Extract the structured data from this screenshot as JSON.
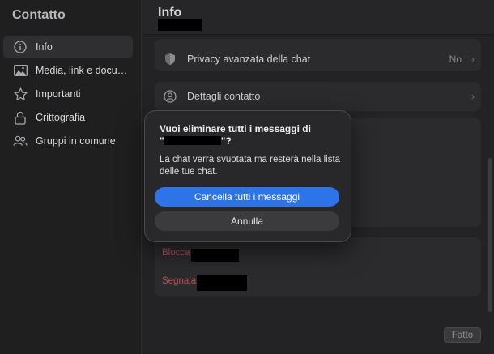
{
  "sidebar": {
    "title": "Contatto",
    "items": [
      {
        "label": "Info",
        "icon": "info-icon"
      },
      {
        "label": "Media, link e documenti",
        "icon": "image-icon"
      },
      {
        "label": "Importanti",
        "icon": "star-icon"
      },
      {
        "label": "Crittografia",
        "icon": "lock-icon"
      },
      {
        "label": "Gruppi in comune",
        "icon": "people-icon"
      }
    ]
  },
  "header": {
    "title": "Info"
  },
  "main": {
    "privacy": {
      "label": "Privacy avanzata della chat",
      "value": "No"
    },
    "contact_details": {
      "label": "Dettagli contatto"
    },
    "block": {
      "label": "Blocca"
    },
    "report": {
      "label": "Segnala"
    },
    "done_label": "Fatto"
  },
  "dialog": {
    "title_prefix": "Vuoi eliminare tutti i messaggi di",
    "title_quote_open": "\"",
    "title_quote_close": "\"?",
    "message": "La chat verrà svuotata ma resterà nella lista delle tue chat.",
    "primary_label": "Cancella tutti i messaggi",
    "secondary_label": "Annulla"
  },
  "colors": {
    "accent": "#2d74e8",
    "danger": "#b84f52",
    "background": "#232325"
  }
}
